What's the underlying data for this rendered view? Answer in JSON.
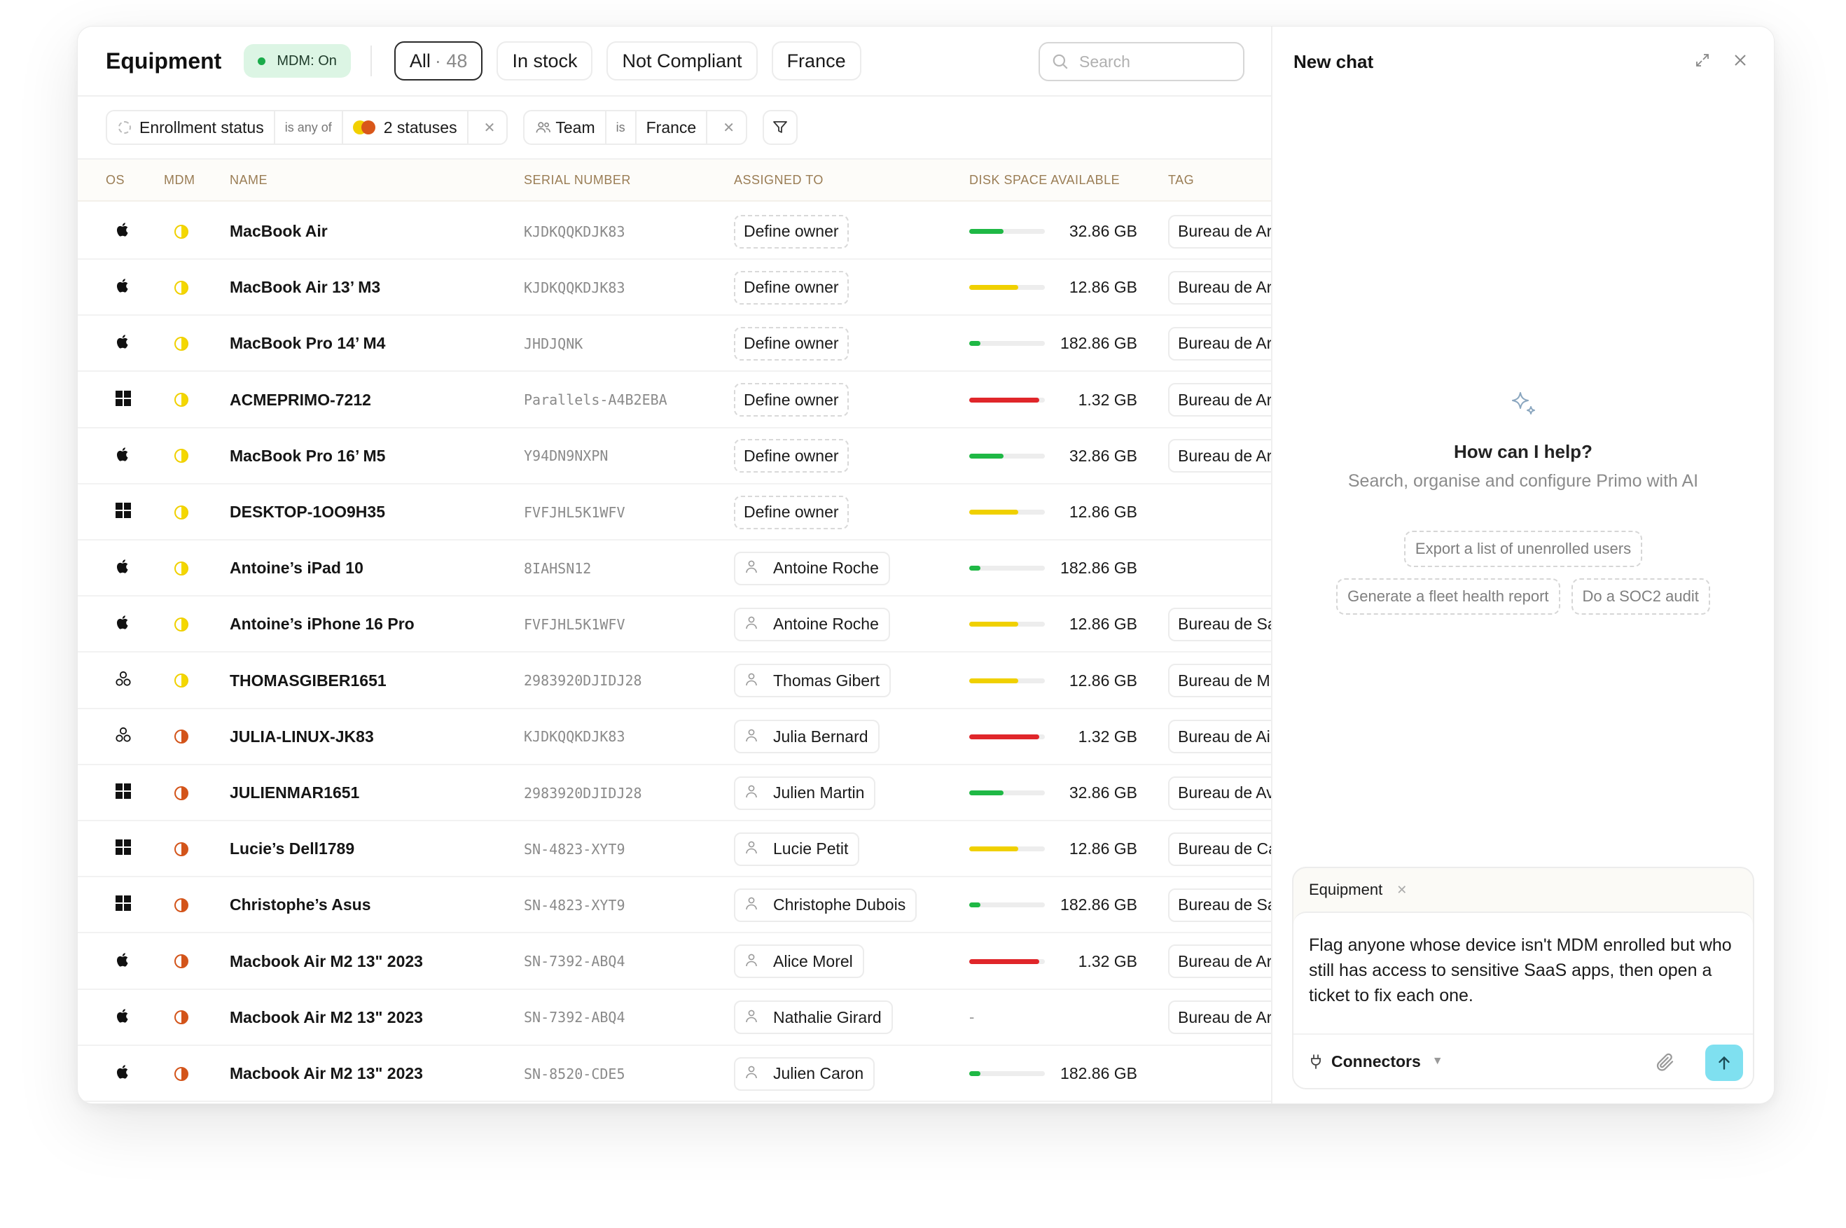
{
  "header": {
    "title": "Equipment",
    "mdm_badge": "MDM: On",
    "tabs": [
      {
        "label": "All",
        "count": "· 48",
        "active": true
      },
      {
        "label": "In stock"
      },
      {
        "label": "Not Compliant"
      },
      {
        "label": "France"
      }
    ],
    "search_placeholder": "Search"
  },
  "filters": [
    {
      "field": "Enrollment status",
      "operator": "is any of",
      "value": "2 statuses"
    },
    {
      "field": "Team",
      "operator": "is",
      "value": "France"
    }
  ],
  "table": {
    "columns": [
      "OS",
      "MDM",
      "NAME",
      "SERIAL NUMBER",
      "ASSIGNED TO",
      "DISK SPACE AVAILABLE",
      "TAG"
    ],
    "rows": [
      {
        "os": "apple",
        "mdm": "pending",
        "name": "MacBook Air",
        "serial": "KJDKQQKDJK83",
        "assigned": "Define owner",
        "owner_defined": false,
        "disk_fraction": 0.45,
        "disk_color": "#1fb845",
        "disk": "32.86 GB",
        "tag": "Bureau de Ar"
      },
      {
        "os": "apple",
        "mdm": "pending",
        "name": "MacBook Air 13’ M3",
        "serial": "KJDKQQKDJK83",
        "assigned": "Define owner",
        "owner_defined": false,
        "disk_fraction": 0.65,
        "disk_color": "#f0d000",
        "disk": "12.86 GB",
        "tag": "Bureau de Ar"
      },
      {
        "os": "apple",
        "mdm": "pending",
        "name": "MacBook Pro 14’ M4",
        "serial": "JHDJQNK",
        "assigned": "Define owner",
        "owner_defined": false,
        "disk_fraction": 0.15,
        "disk_color": "#1fb845",
        "disk": "182.86 GB",
        "tag": "Bureau de Ar"
      },
      {
        "os": "windows",
        "mdm": "pending",
        "name": "ACMEPRIMO-7212",
        "serial": "Parallels-A4B2EBA",
        "assigned": "Define owner",
        "owner_defined": false,
        "disk_fraction": 0.93,
        "disk_color": "#e0262a",
        "disk": "1.32 GB",
        "tag": "Bureau de Ar"
      },
      {
        "os": "apple",
        "mdm": "pending",
        "name": "MacBook Pro 16’ M5",
        "serial": "Y94DN9NXPN",
        "assigned": "Define owner",
        "owner_defined": false,
        "disk_fraction": 0.45,
        "disk_color": "#1fb845",
        "disk": "32.86 GB",
        "tag": "Bureau de Ar"
      },
      {
        "os": "windows",
        "mdm": "pending",
        "name": "DESKTOP-1OO9H35",
        "serial": "FVFJHL5K1WFV",
        "assigned": "Define owner",
        "owner_defined": false,
        "disk_fraction": 0.65,
        "disk_color": "#f0d000",
        "disk": "12.86 GB",
        "tag": ""
      },
      {
        "os": "apple",
        "mdm": "pending",
        "name": "Antoine’s iPad 10",
        "serial": "8IAHSN12",
        "assigned": "Antoine Roche",
        "owner_defined": true,
        "disk_fraction": 0.15,
        "disk_color": "#1fb845",
        "disk": "182.86 GB",
        "tag": ""
      },
      {
        "os": "apple",
        "mdm": "pending",
        "name": "Antoine’s iPhone 16 Pro",
        "serial": "FVFJHL5K1WFV",
        "assigned": "Antoine Roche",
        "owner_defined": true,
        "disk_fraction": 0.65,
        "disk_color": "#f0d000",
        "disk": "12.86 GB",
        "tag": "Bureau de Sa"
      },
      {
        "os": "linux",
        "mdm": "pending",
        "name": "THOMASGIBER1651",
        "serial": "2983920DJIDJ28",
        "assigned": "Thomas Gibert",
        "owner_defined": true,
        "disk_fraction": 0.65,
        "disk_color": "#f0d000",
        "disk": "12.86 GB",
        "tag": "Bureau de M"
      },
      {
        "os": "linux",
        "mdm": "failed",
        "name": "JULIA-LINUX-JK83",
        "serial": "KJDKQQKDJK83",
        "assigned": "Julia Bernard",
        "owner_defined": true,
        "disk_fraction": 0.93,
        "disk_color": "#e0262a",
        "disk": "1.32 GB",
        "tag": "Bureau de Ai"
      },
      {
        "os": "windows",
        "mdm": "failed",
        "name": "JULIENMAR1651",
        "serial": "2983920DJIDJ28",
        "assigned": "Julien Martin",
        "owner_defined": true,
        "disk_fraction": 0.45,
        "disk_color": "#1fb845",
        "disk": "32.86 GB",
        "tag": "Bureau de Av"
      },
      {
        "os": "windows",
        "mdm": "failed",
        "name": "Lucie’s Dell1789",
        "serial": "SN-4823-XYT9",
        "assigned": "Lucie Petit",
        "owner_defined": true,
        "disk_fraction": 0.65,
        "disk_color": "#f0d000",
        "disk": "12.86 GB",
        "tag": "Bureau de Ca"
      },
      {
        "os": "windows",
        "mdm": "failed",
        "name": "Christophe’s Asus",
        "serial": "SN-4823-XYT9",
        "assigned": "Christophe Dubois",
        "owner_defined": true,
        "disk_fraction": 0.15,
        "disk_color": "#1fb845",
        "disk": "182.86 GB",
        "tag": "Bureau de Sa"
      },
      {
        "os": "apple",
        "mdm": "failed",
        "name": "Macbook Air M2 13\" 2023",
        "serial": "SN-7392-ABQ4",
        "assigned": "Alice Morel",
        "owner_defined": true,
        "disk_fraction": 0.93,
        "disk_color": "#e0262a",
        "disk": "1.32 GB",
        "tag": "Bureau de Ar"
      },
      {
        "os": "apple",
        "mdm": "failed",
        "name": "Macbook Air M2 13\" 2023",
        "serial": "SN-7392-ABQ4",
        "assigned": "Nathalie Girard",
        "owner_defined": true,
        "disk_fraction": 0,
        "disk_color": "",
        "disk": "-",
        "tag": "Bureau de Ar"
      },
      {
        "os": "apple",
        "mdm": "failed",
        "name": "Macbook Air M2 13\" 2023",
        "serial": "SN-8520-CDE5",
        "assigned": "Julien Caron",
        "owner_defined": true,
        "disk_fraction": 0.15,
        "disk_color": "#1fb845",
        "disk": "182.86 GB",
        "tag": ""
      }
    ]
  },
  "chat": {
    "title": "New chat",
    "help_title": "How can I help?",
    "help_subtitle": "Search, organise and configure Primo with AI",
    "suggestions": [
      "Export a list of unenrolled users",
      "Generate a fleet health report",
      "Do a SOC2 audit"
    ],
    "context_chip": "Equipment",
    "prompt": "Flag anyone whose device isn't MDM enrolled but who still has access to sensitive SaaS apps, then open a ticket to fix each one.",
    "connectors_label": "Connectors"
  },
  "colors": {
    "accent_send": "#7fe0f0",
    "mdm_on_bg": "#dcf5e4",
    "header_col_text": "#9a7d55"
  }
}
